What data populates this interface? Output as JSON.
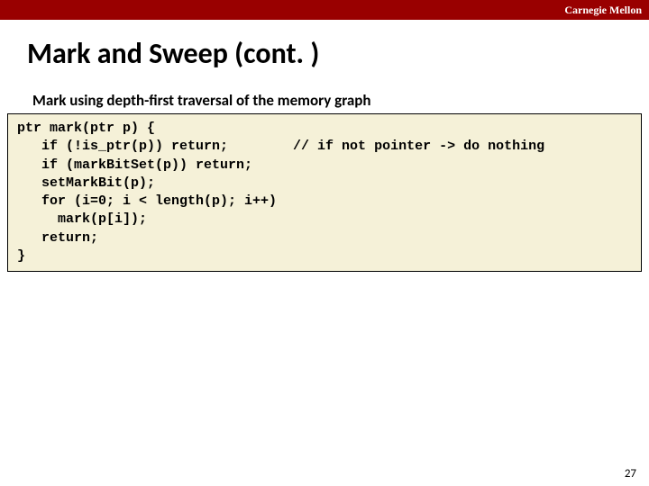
{
  "header": {
    "institution": "Carnegie Mellon"
  },
  "slide": {
    "title": "Mark and Sweep (cont. )",
    "subtitle": "Mark using depth-first traversal of the memory graph",
    "code": "ptr mark(ptr p) {\n   if (!is_ptr(p)) return;        // if not pointer -> do nothing\n   if (markBitSet(p)) return;\n   setMarkBit(p);\n   for (i=0; i < length(p); i++)\n     mark(p[i]);\n   return;\n}",
    "page_number": "27"
  }
}
